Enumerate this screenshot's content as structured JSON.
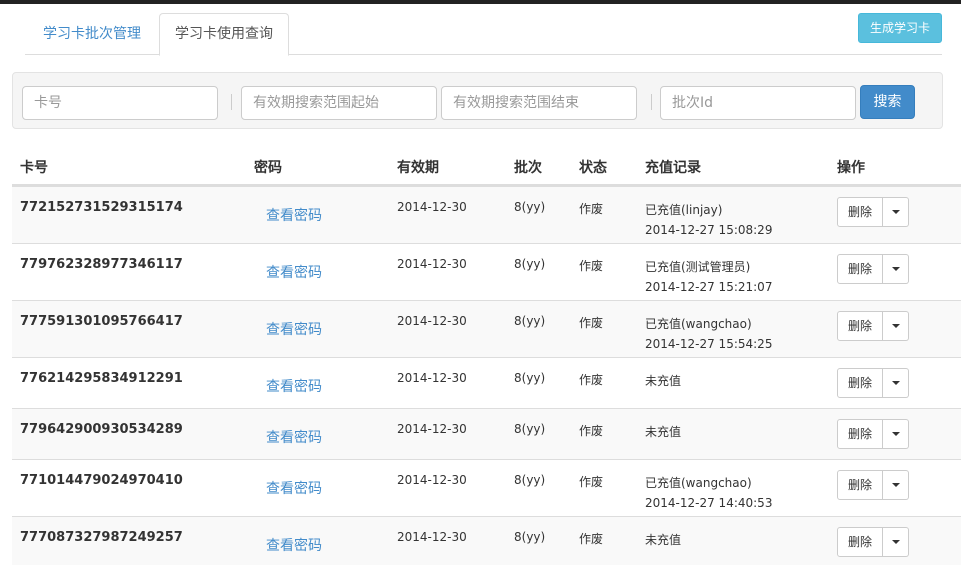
{
  "tabs": [
    {
      "label": "学习卡批次管理"
    },
    {
      "label": "学习卡使用查询"
    }
  ],
  "generate_button": "生成学习卡",
  "search": {
    "card_placeholder": "卡号",
    "start_placeholder": "有效期搜索范围起始",
    "end_placeholder": "有效期搜索范围结束",
    "batch_placeholder": "批次Id",
    "button": "搜索"
  },
  "table": {
    "headers": [
      "卡号",
      "密码",
      "有效期",
      "批次",
      "状态",
      "充值记录",
      "操作"
    ],
    "rows": [
      {
        "card": "772152731529315174",
        "password": "查看密码",
        "expiry": "2014-12-30",
        "batch": "8(yy)",
        "status": "作废",
        "record": "已充值(linjay)",
        "record_time": "2014-12-27 15:08:29",
        "action": "删除"
      },
      {
        "card": "779762328977346117",
        "password": "查看密码",
        "expiry": "2014-12-30",
        "batch": "8(yy)",
        "status": "作废",
        "record": "已充值(测试管理员)",
        "record_time": "2014-12-27 15:21:07",
        "action": "删除"
      },
      {
        "card": "777591301095766417",
        "password": "查看密码",
        "expiry": "2014-12-30",
        "batch": "8(yy)",
        "status": "作废",
        "record": "已充值(wangchao)",
        "record_time": "2014-12-27 15:54:25",
        "action": "删除"
      },
      {
        "card": "776214295834912291",
        "password": "查看密码",
        "expiry": "2014-12-30",
        "batch": "8(yy)",
        "status": "作废",
        "record": "未充值",
        "record_time": "",
        "action": "删除"
      },
      {
        "card": "779642900930534289",
        "password": "查看密码",
        "expiry": "2014-12-30",
        "batch": "8(yy)",
        "status": "作废",
        "record": "未充值",
        "record_time": "",
        "action": "删除"
      },
      {
        "card": "771014479024970410",
        "password": "查看密码",
        "expiry": "2014-12-30",
        "batch": "8(yy)",
        "status": "作废",
        "record": "已充值(wangchao)",
        "record_time": "2014-12-27 14:40:53",
        "action": "删除"
      },
      {
        "card": "777087327987249257",
        "password": "查看密码",
        "expiry": "2014-12-30",
        "batch": "8(yy)",
        "status": "作废",
        "record": "未充值",
        "record_time": "",
        "action": "删除"
      }
    ]
  }
}
